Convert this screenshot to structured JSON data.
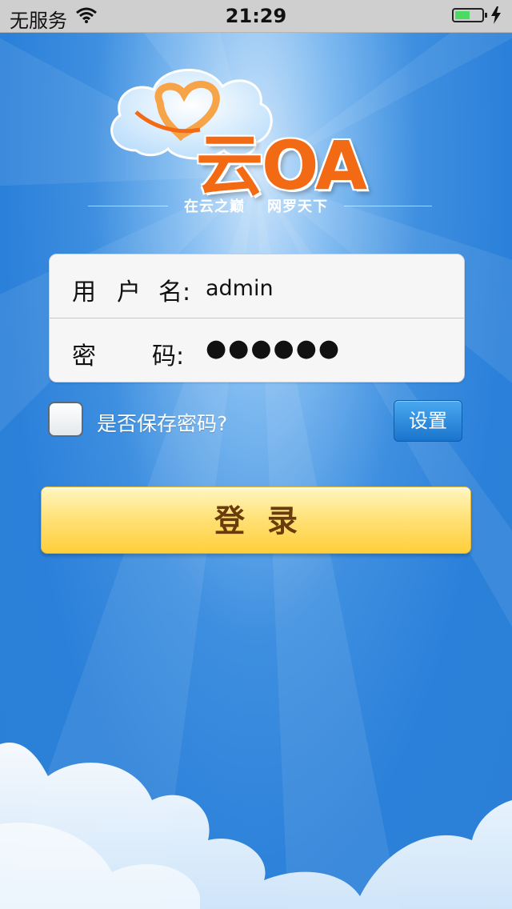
{
  "status_bar": {
    "carrier": "无服务",
    "time": "21:29",
    "wifi_icon": "wifi-icon",
    "battery_icon": "battery-charging-icon"
  },
  "logo": {
    "text": "云OA",
    "tagline_left": "在云之巅",
    "tagline_right": "网罗天下",
    "accent_color": "#f26a14"
  },
  "form": {
    "username": {
      "label_chars": [
        "用",
        "户",
        "名:"
      ],
      "value": "admin"
    },
    "password": {
      "label_chars": [
        "密",
        "码:"
      ],
      "value": "●●●●●●"
    }
  },
  "remember": {
    "label": "是否保存密码?",
    "checked": false
  },
  "buttons": {
    "settings": "设置",
    "login": "登录"
  },
  "colors": {
    "background": "#2b80d9",
    "login_button": "#ffd54a",
    "settings_button": "#1f7ad3"
  }
}
